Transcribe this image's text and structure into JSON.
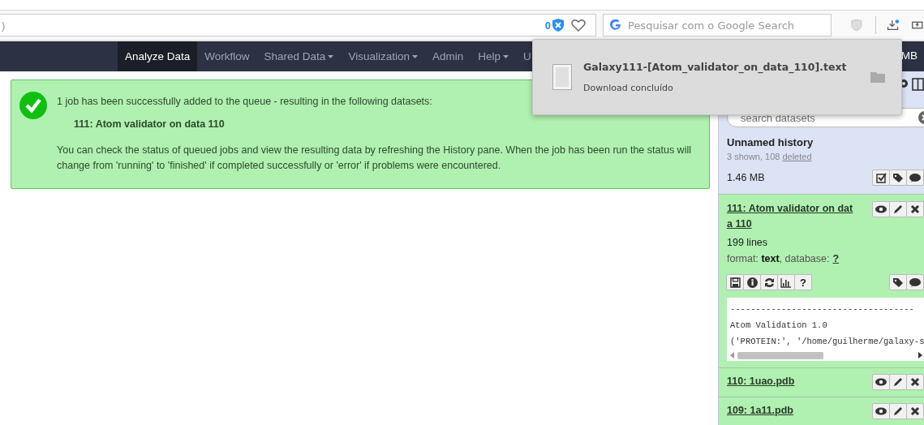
{
  "browser": {
    "url_fragment": ")",
    "tracker_count": "0",
    "search_placeholder": "Pesquisar com o Google Search",
    "download_new": true
  },
  "download_popup": {
    "filename": "Galaxy111-[Atom_validator_on_data_110].text",
    "status": "Download concluído"
  },
  "navbar": {
    "items": [
      {
        "label": "Analyze Data",
        "selected": true,
        "dropdown": false
      },
      {
        "label": "Workflow",
        "selected": false,
        "dropdown": false
      },
      {
        "label": "Shared Data",
        "selected": false,
        "dropdown": true
      },
      {
        "label": "Visualization",
        "selected": false,
        "dropdown": true
      },
      {
        "label": "Admin",
        "selected": false,
        "dropdown": false
      },
      {
        "label": "Help",
        "selected": false,
        "dropdown": true
      },
      {
        "label": "U",
        "selected": false,
        "dropdown": false
      }
    ],
    "right_text": "MB"
  },
  "message": {
    "text": "1 job has been successfully added to the queue - resulting in the following datasets:",
    "dataset": "111: Atom validator on data 110",
    "note": "You can check the status of queued jobs and view the resulting data by refreshing the History pane. When the job has been run the status will change from 'running' to 'finished' if completed successfully or 'error' if problems were encountered."
  },
  "history": {
    "search_placeholder": "search datasets",
    "name": "Unnamed history",
    "shown": "3 shown, 108",
    "deleted_link": "deleted",
    "size": "1.46 MB",
    "datasets": [
      {
        "title": "111: Atom validator on data 110",
        "expanded": true,
        "lines": "199 lines",
        "format_text": "format: **text**, database:",
        "database_link": "?",
        "help_label": "?",
        "peek": [
          "------------------------------------",
          "Atom Validation 1.0",
          "('PROTEIN:', '/home/guilherme/galaxy-s"
        ]
      },
      {
        "title": "110: 1uao.pdb",
        "expanded": false
      },
      {
        "title": "109: 1a11.pdb",
        "expanded": false
      }
    ]
  }
}
